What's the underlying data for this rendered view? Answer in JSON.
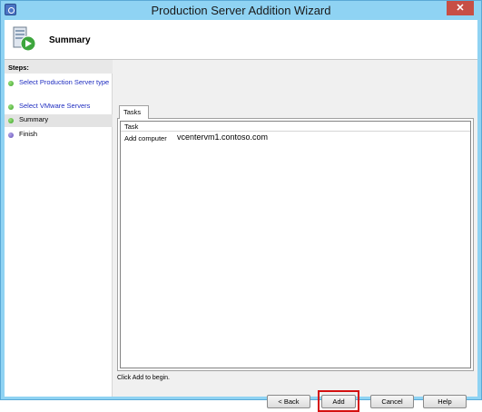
{
  "window": {
    "title": "Production Server Addition Wizard",
    "close_glyph": "✕"
  },
  "header": {
    "title": "Summary",
    "icon": "server-wizard-icon"
  },
  "steps": {
    "heading": "Steps:",
    "items": [
      {
        "label": "Select Production Server type",
        "status": "done"
      },
      {
        "label": "Select VMware Servers",
        "status": "done"
      },
      {
        "label": "Summary",
        "status": "current"
      },
      {
        "label": "Finish",
        "status": "pending"
      }
    ]
  },
  "tasks_tab": {
    "label": "Tasks",
    "column_header": "Task",
    "rows": [
      {
        "action": "Add computer",
        "server": "vcentervm1.contoso.com"
      }
    ]
  },
  "status": "Click Add to begin.",
  "buttons": {
    "back": "< Back",
    "add": "Add",
    "cancel": "Cancel",
    "help": "Help"
  },
  "colors": {
    "title_bar": "#8fd3f3",
    "link": "#1f2dc0",
    "highlight": "#d41010"
  }
}
